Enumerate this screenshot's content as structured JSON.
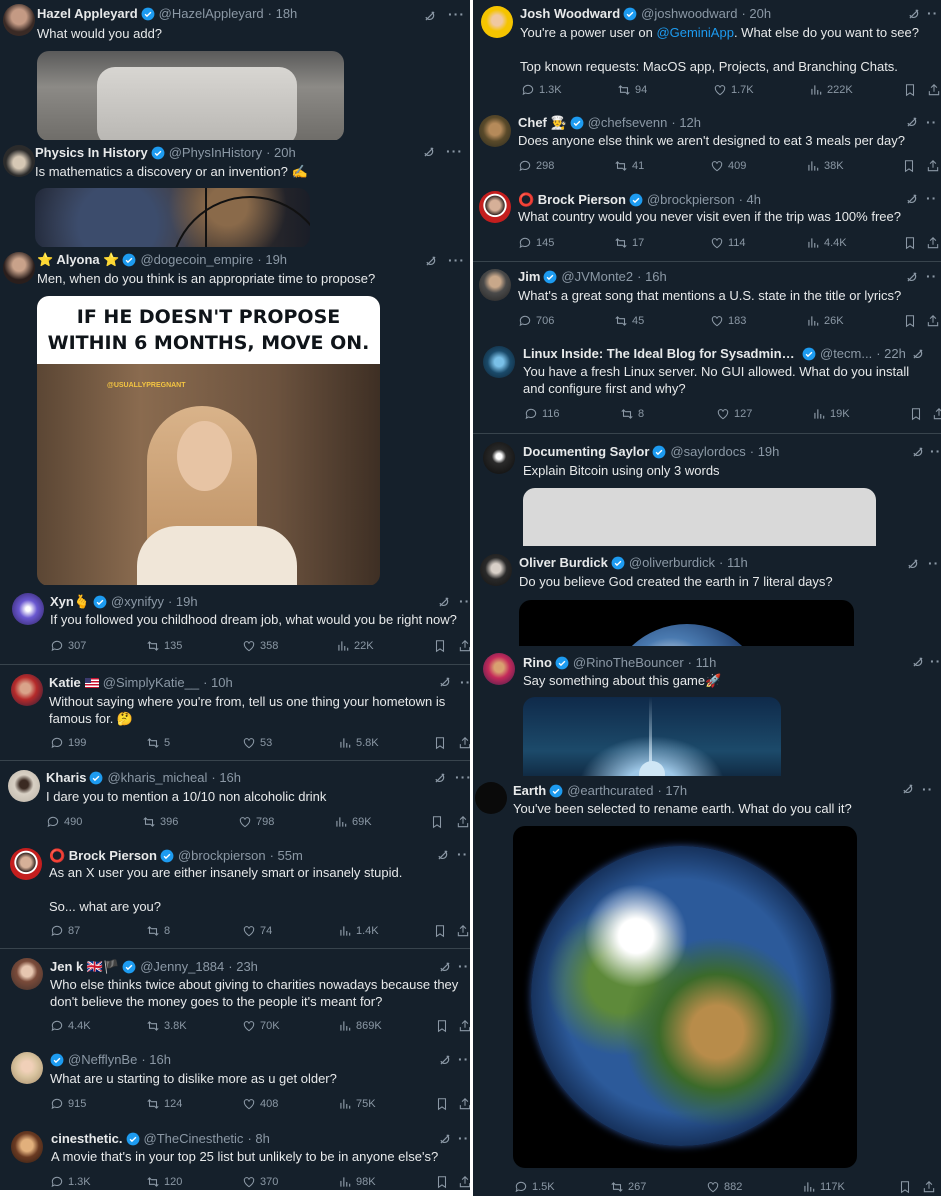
{
  "left_column": [
    {
      "id": "hazel",
      "name": "Hazel Appleyard",
      "verified": true,
      "handle": "@HazelAppleyard",
      "time": "· 18h",
      "text": "What would you add?",
      "stats": null
    },
    {
      "id": "physics",
      "name": "Physics In History",
      "verified": true,
      "handle": "@PhysInHistory",
      "time": "· 20h",
      "text": "Is mathematics a discovery or an invention? ✍️",
      "stats": null
    },
    {
      "id": "alyona",
      "name": "⭐ Alyona ⭐",
      "verified": true,
      "handle": "@dogecoin_empire",
      "time": "· 19h",
      "text": "Men, when do you think is an appropriate time to propose?",
      "stats": null,
      "meme": {
        "line1": "IF HE DOESN'T PROPOSE",
        "line2": "WITHIN 6 MONTHS, MOVE ON.",
        "watermark": "@USUALLYPREGNANT"
      }
    },
    {
      "id": "xyn",
      "name": "Xyn🫰",
      "verified": true,
      "handle": "@xynifyy",
      "time": "· 19h",
      "text": "If you followed you childhood dream job, what would you be right now?",
      "stats": {
        "replies": "307",
        "reposts": "135",
        "likes": "358",
        "views": "22K"
      }
    },
    {
      "id": "katie",
      "name": "Katie",
      "flag": "us",
      "verified": false,
      "handle": "@SimplyKatie__",
      "time": "· 10h",
      "text": "Without saying where you're from, tell us one thing your hometown is famous for. 🤔",
      "stats": {
        "replies": "199",
        "reposts": "5",
        "likes": "53",
        "views": "5.8K"
      }
    },
    {
      "id": "kharis",
      "name": "Kharis",
      "verified": true,
      "handle": "@kharis_micheal",
      "time": "· 16h",
      "text": "I dare you to mention a 10/10 non alcoholic drink",
      "stats": {
        "replies": "490",
        "reposts": "396",
        "likes": "798",
        "views": "69K"
      }
    },
    {
      "id": "brock1",
      "name": "⭕ Brock Pierson",
      "verified": true,
      "handle": "@brockpierson",
      "time": "· 55m",
      "text": "As an X user you are either insanely smart or insanely stupid.\n\nSo... what are you?",
      "stats": {
        "replies": "87",
        "reposts": "8",
        "likes": "74",
        "views": "1.4K"
      }
    },
    {
      "id": "jenk",
      "name": "Jen k 🇬🇧🏴",
      "verified": true,
      "handle": "@Jenny_1884",
      "time": "· 23h",
      "text": "Who else thinks twice about giving to charities nowadays because they don't believe the money goes to the people it's meant for?",
      "stats": {
        "replies": "4.4K",
        "reposts": "3.8K",
        "likes": "70K",
        "views": "869K"
      }
    },
    {
      "id": "nefflyn",
      "name": "",
      "verified": true,
      "handle": "@NefflynBe",
      "time": "· 16h",
      "text": "What are u starting to dislike more as u get older?",
      "stats": {
        "replies": "915",
        "reposts": "124",
        "likes": "408",
        "views": "75K"
      }
    },
    {
      "id": "cine",
      "name": "cinesthetic.",
      "verified": true,
      "handle": "@TheCinesthetic",
      "time": "· 8h",
      "text": "A movie that's in your top 25 list but unlikely to be in anyone else's?",
      "stats": {
        "replies": "1.3K",
        "reposts": "120",
        "likes": "370",
        "views": "98K"
      }
    }
  ],
  "right_column": [
    {
      "id": "josh",
      "name": "Josh Woodward",
      "verified": true,
      "handle": "@joshwoodward",
      "time": "· 20h",
      "text_before": "You're a power user on ",
      "mention": "@GeminiApp",
      "text_after": ". What else do you want to see?\n\nTop known requests: MacOS app, Projects, and Branching Chats.",
      "stats": {
        "replies": "1.3K",
        "reposts": "94",
        "likes": "1.7K",
        "views": "222K"
      }
    },
    {
      "id": "chef",
      "name": "Chef 👨‍🍳",
      "verified": true,
      "handle": "@chefsevenn",
      "time": "· 12h",
      "text": "Does anyone else think we aren't designed to eat 3 meals per day?",
      "stats": {
        "replies": "298",
        "reposts": "41",
        "likes": "409",
        "views": "38K"
      }
    },
    {
      "id": "brock2",
      "name": "⭕ Brock Pierson",
      "verified": true,
      "handle": "@brockpierson",
      "time": "· 4h",
      "text": "What country would you never visit even if the trip was 100% free?",
      "stats": {
        "replies": "145",
        "reposts": "17",
        "likes": "114",
        "views": "4.4K"
      }
    },
    {
      "id": "jim",
      "name": "Jim",
      "verified": true,
      "handle": "@JVMonte2",
      "time": "· 16h",
      "text": "What's a great song that mentions a U.S. state in the title or lyrics?",
      "stats": {
        "replies": "706",
        "reposts": "45",
        "likes": "183",
        "views": "26K"
      }
    },
    {
      "id": "linux",
      "name": "Linux Inside: The Ideal Blog for Sysadmins & ...",
      "verified": true,
      "handle": "@tecm...",
      "time": "· 22h",
      "text": "You have a fresh Linux server. No GUI allowed. What do you install and configure first and why?",
      "stats": {
        "replies": "116",
        "reposts": "8",
        "likes": "127",
        "views": "19K"
      }
    },
    {
      "id": "saylor",
      "name": "Documenting Saylor",
      "verified": true,
      "handle": "@saylordocs",
      "time": "· 19h",
      "text": "Explain Bitcoin using only 3 words",
      "stats": null
    },
    {
      "id": "oliver",
      "name": "Oliver Burdick",
      "verified": true,
      "handle": "@oliverburdick",
      "time": "· 11h",
      "text": "Do you believe God created the earth in 7 literal days?",
      "stats": null
    },
    {
      "id": "rino",
      "name": "Rino",
      "verified": true,
      "handle": "@RinoTheBouncer",
      "time": "· 11h",
      "text": "Say something about this game🚀",
      "stats": null
    },
    {
      "id": "earth",
      "name": "Earth",
      "verified": true,
      "handle": "@earthcurated",
      "time": "· 17h",
      "text": "You've been selected to rename earth. What do you call it?",
      "stats": {
        "replies": "1.5K",
        "reposts": "267",
        "likes": "882",
        "views": "117K"
      }
    }
  ],
  "colors": {
    "background": "#15202b",
    "text": "#e7e9ea",
    "muted": "#8b98a5",
    "accent": "#1d9bf0",
    "divider": "#38444d"
  },
  "icons": [
    "verified-badge-icon",
    "grok-icon",
    "more-icon",
    "reply-icon",
    "repost-icon",
    "like-icon",
    "views-icon",
    "bookmark-icon",
    "share-icon"
  ]
}
